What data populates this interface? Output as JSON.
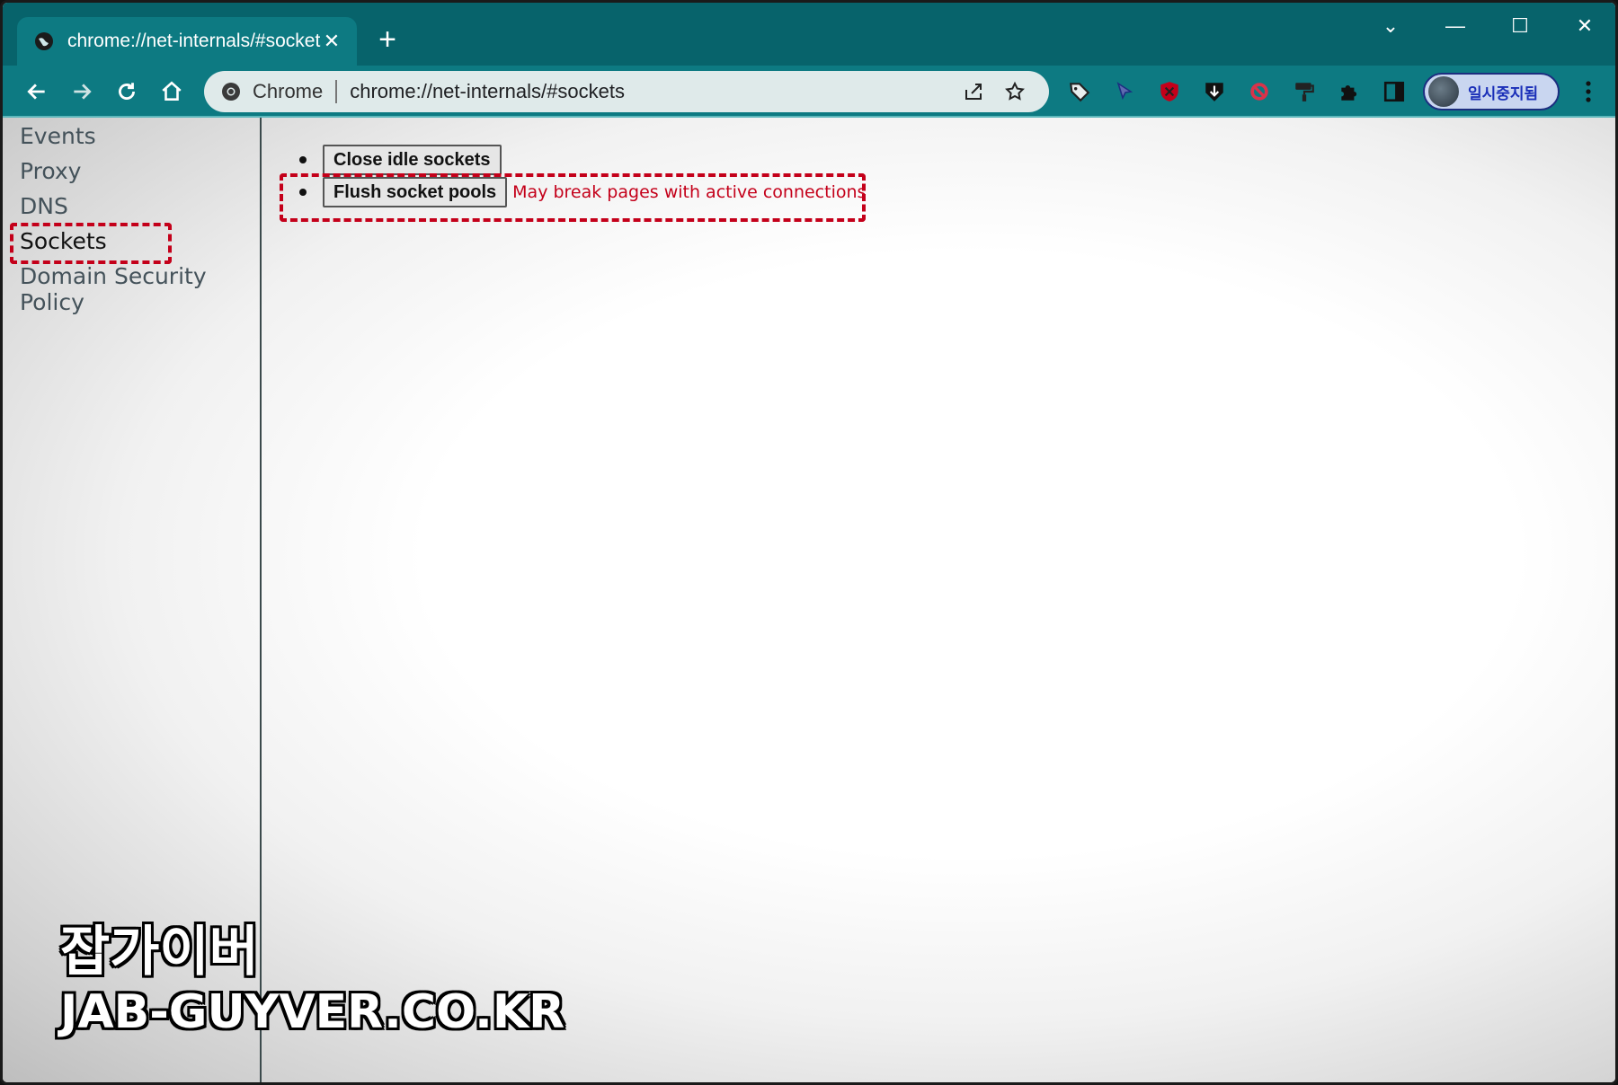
{
  "tab": {
    "title": "chrome://net-internals/#sockets",
    "close_glyph": "✕"
  },
  "newtab_glyph": "+",
  "window_controls": {
    "dropdown": "⌄",
    "minimize": "—",
    "maximize": "☐",
    "close": "✕"
  },
  "omnibox": {
    "chip_label": "Chrome",
    "url": "chrome://net-internals/#sockets"
  },
  "profile": {
    "label": "일시중지됨"
  },
  "sidebar": {
    "items": [
      {
        "label": "Events"
      },
      {
        "label": "Proxy"
      },
      {
        "label": "DNS"
      },
      {
        "label": "Sockets"
      },
      {
        "label": "Domain Security Policy"
      }
    ]
  },
  "main": {
    "close_idle_label": "Close idle sockets",
    "flush_label": "Flush socket pools",
    "flush_warning": "May break pages with active connections"
  },
  "watermark": {
    "korean": "잡가이버",
    "site": "JAB-GUYVER.CO.KR"
  },
  "colors": {
    "theme": "#0d7a82",
    "highlight": "#c4001a",
    "warning": "#c4001a"
  }
}
